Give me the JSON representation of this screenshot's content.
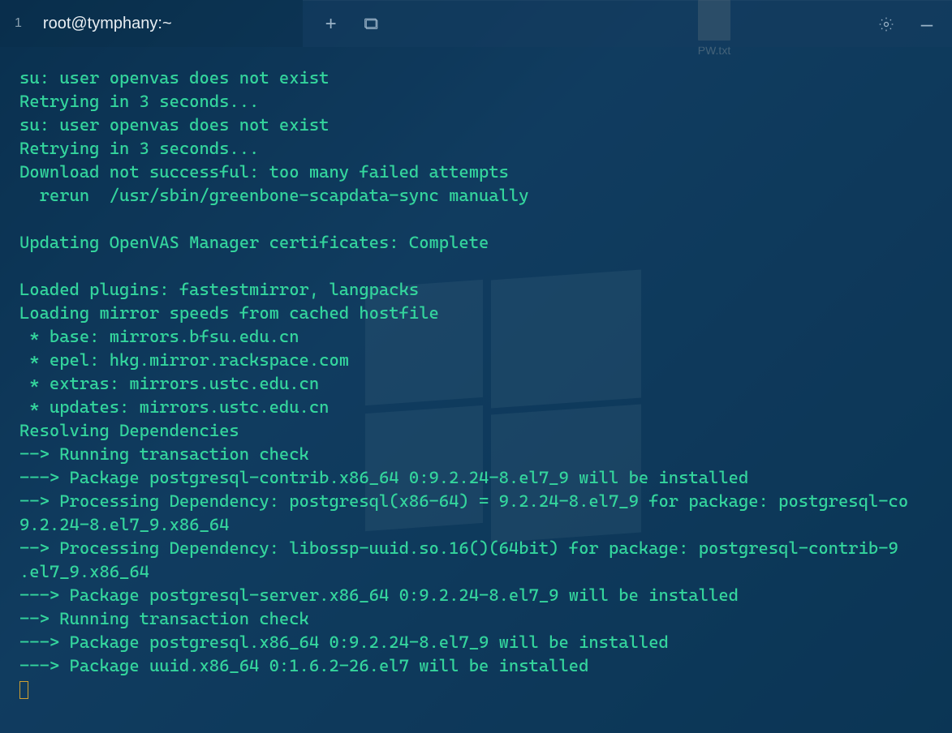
{
  "desktop": {
    "file": {
      "label": "PW.txt"
    }
  },
  "titlebar": {
    "tab": {
      "index": "1",
      "title": "root@tymphany:~"
    }
  },
  "terminal": {
    "lines": [
      "su: user openvas does not exist",
      "Retrying in 3 seconds...",
      "su: user openvas does not exist",
      "Retrying in 3 seconds...",
      "Download not successful: too many failed attempts",
      "  rerun  /usr/sbin/greenbone-scapdata-sync manually",
      "",
      "Updating OpenVAS Manager certificates: Complete",
      "",
      "Loaded plugins: fastestmirror, langpacks",
      "Loading mirror speeds from cached hostfile",
      " * base: mirrors.bfsu.edu.cn",
      " * epel: hkg.mirror.rackspace.com",
      " * extras: mirrors.ustc.edu.cn",
      " * updates: mirrors.ustc.edu.cn",
      "Resolving Dependencies",
      "--> Running transaction check",
      "---> Package postgresql-contrib.x86_64 0:9.2.24-8.el7_9 will be installed",
      "--> Processing Dependency: postgresql(x86-64) = 9.2.24-8.el7_9 for package: postgresql-co",
      "9.2.24-8.el7_9.x86_64",
      "--> Processing Dependency: libossp-uuid.so.16()(64bit) for package: postgresql-contrib-9",
      ".el7_9.x86_64",
      "---> Package postgresql-server.x86_64 0:9.2.24-8.el7_9 will be installed",
      "--> Running transaction check",
      "---> Package postgresql.x86_64 0:9.2.24-8.el7_9 will be installed",
      "---> Package uuid.x86_64 0:1.6.2-26.el7 will be installed"
    ]
  }
}
